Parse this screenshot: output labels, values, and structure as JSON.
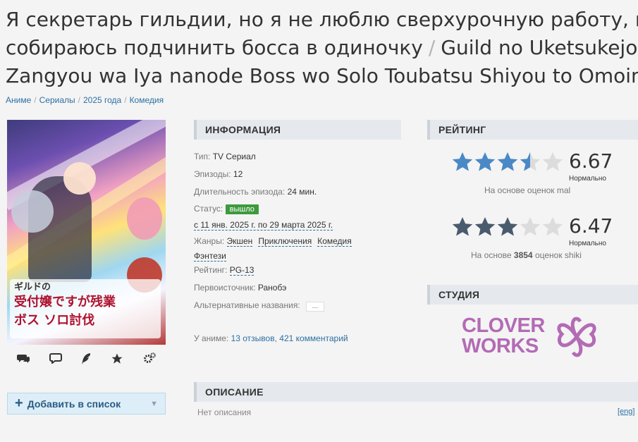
{
  "title": {
    "line_ru_1": "Я секретарь гильдии, но я не люблю сверхурочную работу, поэтому",
    "line_ru_2": "собираюсь подчинить босса в одиночку",
    "slash": "/",
    "line_romaji_1": "Guild no Uketsukejou desu ga,",
    "line_romaji_2": "Zangyou wa Iya nanode Boss wo Solo Toubatsu Shiyou to Omoimasu"
  },
  "breadcrumb": {
    "items": [
      "Аниме",
      "Сериалы",
      "2025 года",
      "Комедия"
    ],
    "sep": "/"
  },
  "poster": {
    "logo_text_1": "ギルドの",
    "logo_text_2": "受付嬢ですが残業",
    "logo_text_3": "ボス ソロ討伐"
  },
  "actions": {
    "icons": [
      "comments-icon",
      "reviews-icon",
      "feather-icon",
      "star-icon",
      "cogs-icon"
    ],
    "add_label": "Добавить в список"
  },
  "info": {
    "heading": "ИНФОРМАЦИЯ",
    "type_key": "Тип:",
    "type_val": "TV Сериал",
    "episodes_key": "Эпизоды:",
    "episodes_val": "12",
    "duration_key": "Длительность эпизода:",
    "duration_val": "24 мин.",
    "status_key": "Статус:",
    "status_val": "вышло",
    "dates": "с 11 янв. 2025 г. по 29 марта 2025 г.",
    "genres_key": "Жанры:",
    "genres": [
      "Экшен",
      "Приключения",
      "Комедия",
      "Фэнтези"
    ],
    "rating_key": "Рейтинг:",
    "rating_val": "PG-13",
    "source_key": "Первоисточник:",
    "source_val": "Ранобэ",
    "alt_key": "Альтернативные названия:",
    "alt_val": "...",
    "reviews_key": "У аниме:",
    "reviews_val": "13 отзывов",
    "comments_val": "421 комментарий",
    "comma": ","
  },
  "rating": {
    "heading": "РЕЙТИНГ",
    "mal": {
      "score": "6.67",
      "label": "Нормально",
      "based": "На основе оценок mal",
      "stars_filled": 3.5,
      "color": "#4a89c6"
    },
    "shiki": {
      "score": "6.47",
      "label": "Нормально",
      "based_pre": "На основе",
      "based_count": "3854",
      "based_post": "оценок shiki",
      "stars_filled": 3,
      "color": "#4a5b6e"
    }
  },
  "studio": {
    "heading": "СТУДИЯ",
    "logo_line1": "CLOVER",
    "logo_line2": "WORKS",
    "color": "#b36bb5"
  },
  "description": {
    "heading": "ОПИСАНИЕ",
    "text": "Нет описания",
    "lang": "[eng]"
  }
}
